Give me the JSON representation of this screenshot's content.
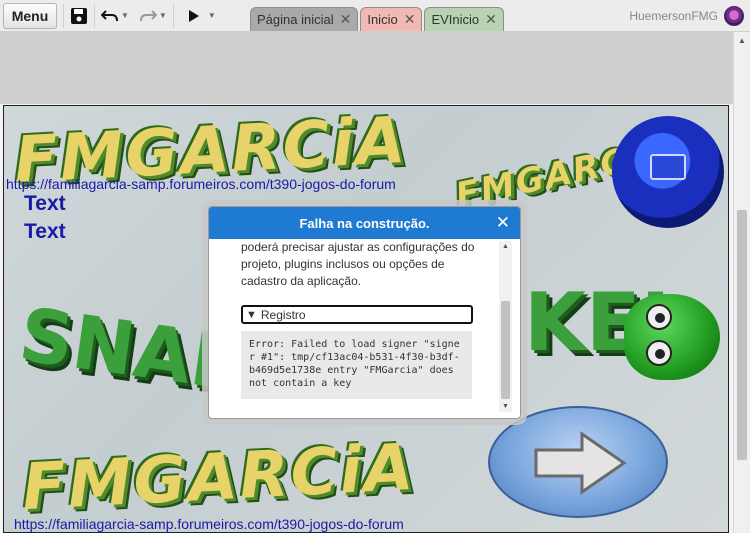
{
  "toolbar": {
    "menu_label": "Menu",
    "save_icon": "save-icon",
    "undo_icon": "undo-icon",
    "redo_icon": "redo-icon",
    "play_icon": "play-icon"
  },
  "tabs": [
    {
      "label": "Página inicial",
      "color": "#a9a9a9"
    },
    {
      "label": "Inicio",
      "color": "#f2b9b3"
    },
    {
      "label": "EVInicio",
      "color": "#b7d3b1"
    }
  ],
  "user": {
    "name": "HuemersonFMG"
  },
  "game": {
    "link_text": "https://familiagarcia-samp.forumeiros.com/t390-jogos-do-forum",
    "text_lines": [
      "Text",
      "Text"
    ],
    "logo_text": "FMGARCiA",
    "logo_small_text": "FMGARCiA",
    "snake_left": "SNAKE",
    "snake_right": "KEL"
  },
  "modal": {
    "title": "Falha na construção.",
    "message": "poderá precisar ajustar as configurações do projeto, plugins inclusos ou opções de cadastro da aplicação.",
    "details_label": "Registro",
    "log": "Error: Failed to load signer \"signer #1\": tmp/cf13ac04-b531-4f30-b3df-b469d5e1738e entry \"FMGarcia\" does not contain a key"
  },
  "colors": {
    "accent": "#1f7ad2",
    "link": "#1a1aa6"
  }
}
